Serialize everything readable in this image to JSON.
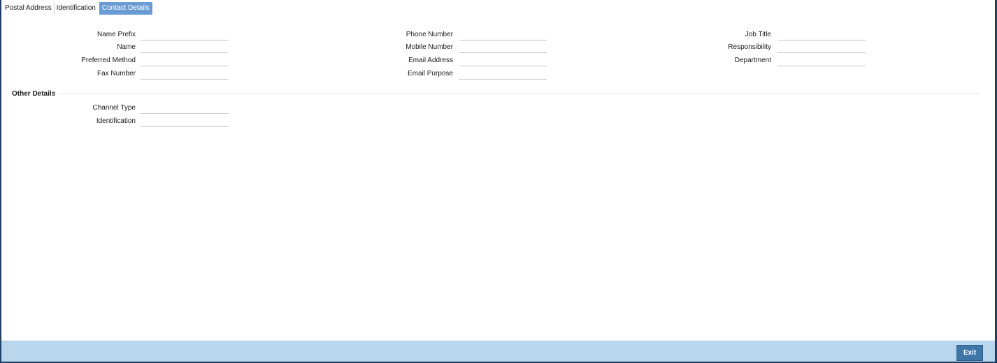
{
  "tabs": [
    {
      "label": "Postal Address",
      "active": false
    },
    {
      "label": "Identification",
      "active": false
    },
    {
      "label": "Contact Details",
      "active": true
    }
  ],
  "contact": {
    "col1": [
      {
        "label": "Name Prefix",
        "value": ""
      },
      {
        "label": "Name",
        "value": ""
      },
      {
        "label": "Preferred Method",
        "value": ""
      },
      {
        "label": "Fax Number",
        "value": ""
      }
    ],
    "col2": [
      {
        "label": "Phone Number",
        "value": ""
      },
      {
        "label": "Mobile Number",
        "value": ""
      },
      {
        "label": "Email Address",
        "value": ""
      },
      {
        "label": "Email Purpose",
        "value": ""
      }
    ],
    "col3": [
      {
        "label": "Job Title",
        "value": ""
      },
      {
        "label": "Responsibility",
        "value": ""
      },
      {
        "label": "Department",
        "value": ""
      }
    ]
  },
  "other_details": {
    "title": "Other Details",
    "fields": [
      {
        "label": "Channel Type",
        "value": ""
      },
      {
        "label": "Identification",
        "value": ""
      }
    ]
  },
  "footer": {
    "exit_label": "Exit"
  },
  "colors": {
    "active_tab": "#6a9bd2",
    "footer_bar": "#bad6ec",
    "exit_button": "#3f76a8",
    "window_border": "#1f3f66"
  }
}
